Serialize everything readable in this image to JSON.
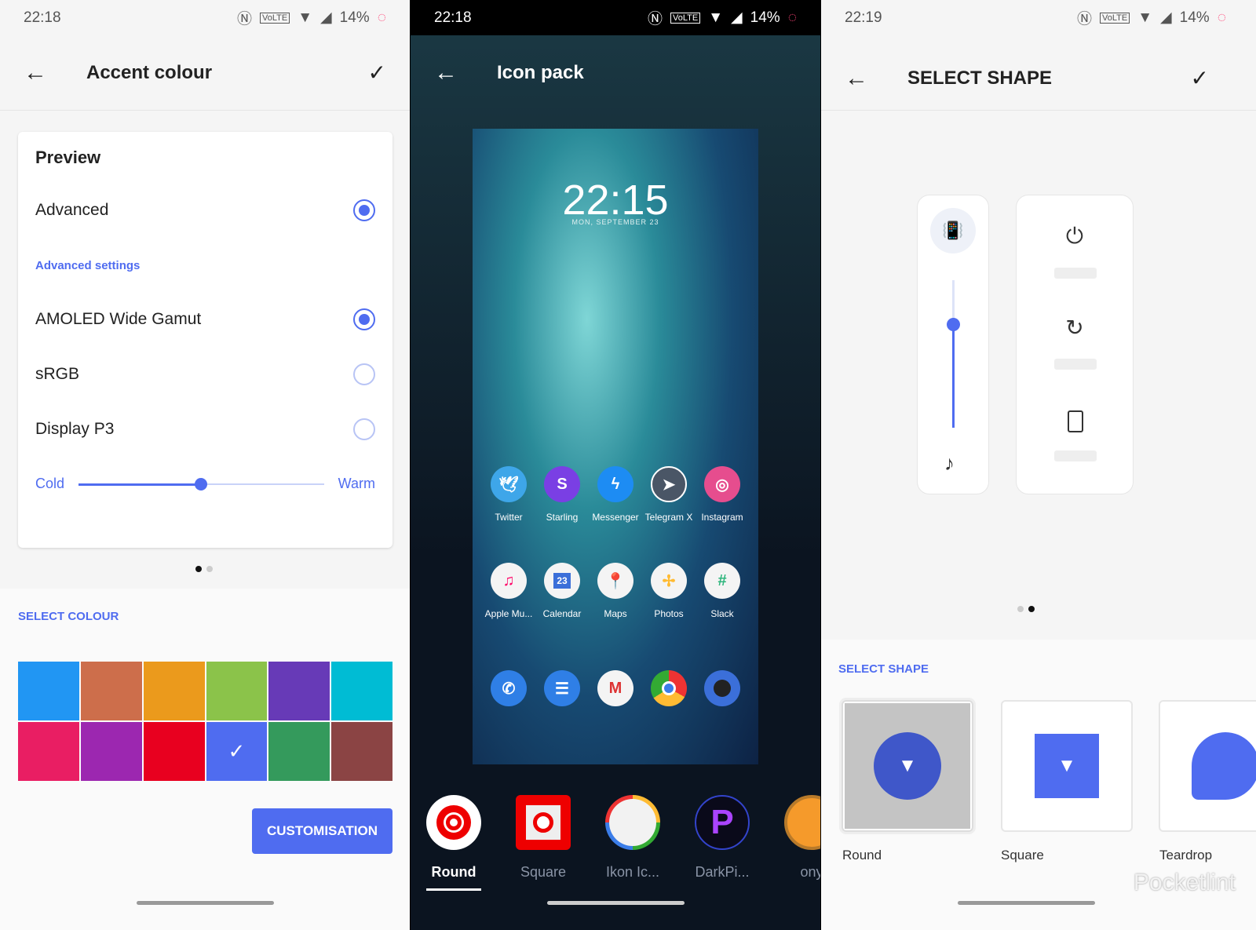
{
  "panel1": {
    "status": {
      "time": "22:18",
      "battery": "14%"
    },
    "title": "Accent colour",
    "preview": {
      "heading": "Preview",
      "mode": "Advanced",
      "advanced_settings": "Advanced settings",
      "options": [
        {
          "label": "AMOLED Wide Gamut",
          "selected": true
        },
        {
          "label": "sRGB",
          "selected": false
        },
        {
          "label": "Display P3",
          "selected": false
        }
      ],
      "cold": "Cold",
      "warm": "Warm",
      "temperature_percent": 50
    },
    "select_colour": "SELECT COLOUR",
    "colours": [
      "#2196f3",
      "#cd6e4b",
      "#eb9a1c",
      "#8bc34a",
      "#673ab7",
      "#00bcd4",
      "#e91e63",
      "#9c27b0",
      "#e8001f",
      "#4f6cf0",
      "#349a5c",
      "#8b4444"
    ],
    "selected_colour_index": 9,
    "customisation": "CUSTOMISATION"
  },
  "panel2": {
    "status": {
      "time": "22:18",
      "battery": "14%"
    },
    "title": "Icon pack",
    "clock": "22:15",
    "date": "MON, SEPTEMBER 23",
    "apps_row1": [
      "Twitter",
      "Starling",
      "Messenger",
      "Telegram X",
      "Instagram"
    ],
    "apps_row2": [
      "Apple Mu...",
      "Calendar",
      "Maps",
      "Photos",
      "Slack"
    ],
    "calendar_day": "23",
    "dock": [
      "phone",
      "messages",
      "gmail",
      "chrome",
      "camera"
    ],
    "packs": [
      "Round",
      "Square",
      "Ikon Ic...",
      "DarkPi...",
      "ony"
    ],
    "selected_pack": "Round"
  },
  "panel3": {
    "status": {
      "time": "22:19",
      "battery": "14%"
    },
    "title": "SELECT SHAPE",
    "section": "SELECT SHAPE",
    "volume_percent": 70,
    "shapes": [
      "Round",
      "Square",
      "Teardrop"
    ],
    "selected_shape": "Round",
    "watermark": "Pocketlint"
  }
}
